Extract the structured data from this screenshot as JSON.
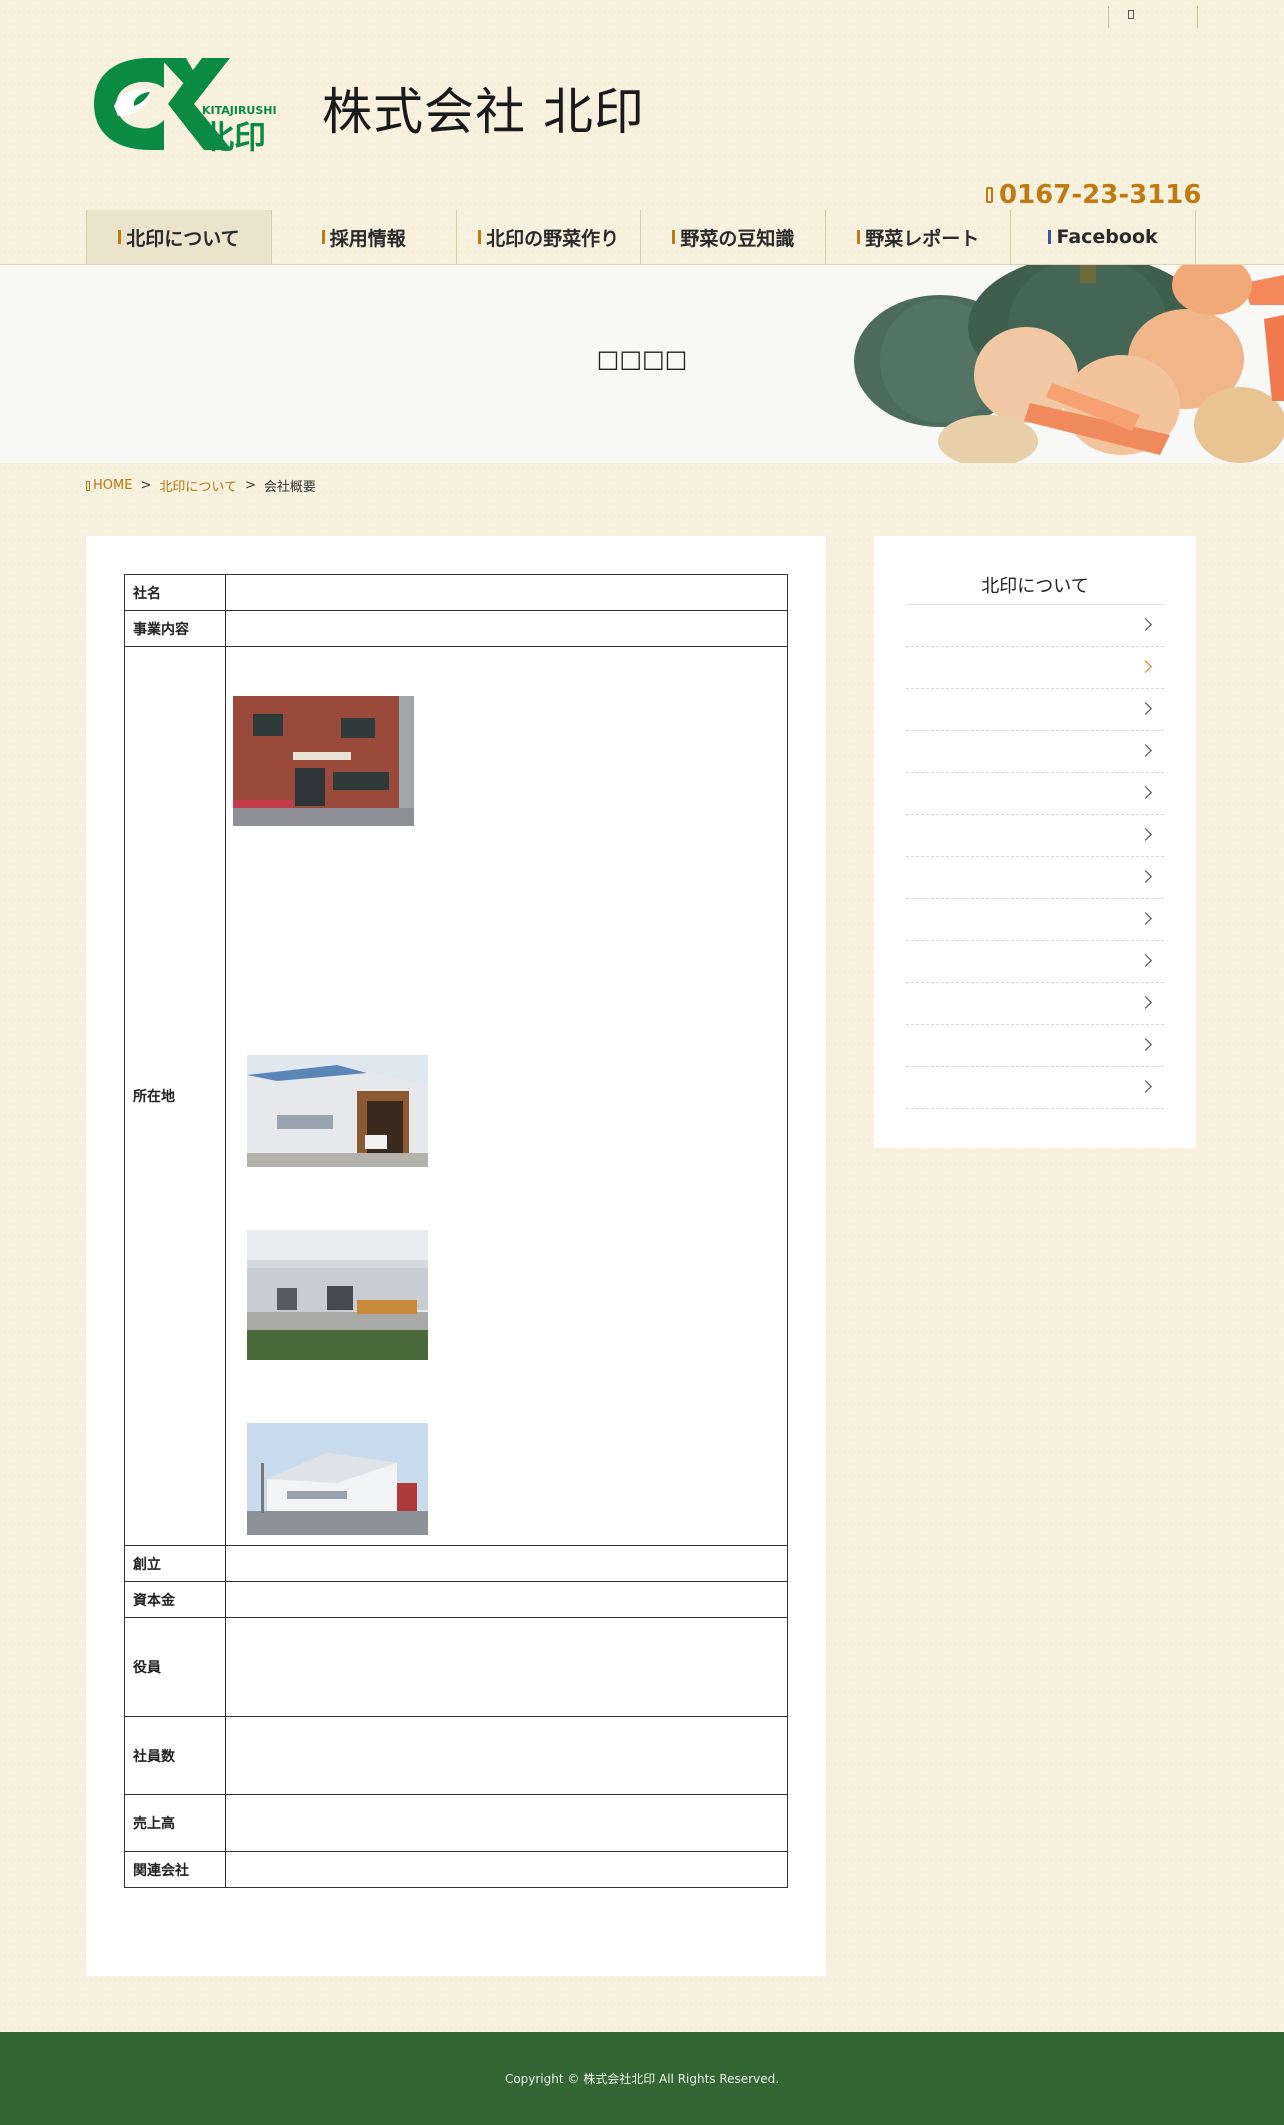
{
  "header": {
    "company_name": "株式会社 北印",
    "logo_text_roman": "KITAJIRUSHI",
    "logo_text_kanji": "北印",
    "phone": "0167-23-3116"
  },
  "nav": {
    "items": [
      {
        "label": "北印について"
      },
      {
        "label": "採用情報"
      },
      {
        "label": "北印の野菜作り"
      },
      {
        "label": "野菜の豆知識"
      },
      {
        "label": "野菜レポート"
      },
      {
        "label": "Facebook"
      }
    ]
  },
  "hero": {
    "title": "□□□□"
  },
  "breadcrumb": {
    "home": "HOME",
    "sep": ">",
    "parent": "北印について",
    "current": "会社概要"
  },
  "profile": {
    "rows": [
      {
        "label": "社名"
      },
      {
        "label": "事業内容"
      },
      {
        "label": "所在地"
      },
      {
        "label": "創立"
      },
      {
        "label": "資本金"
      },
      {
        "label": "役員"
      },
      {
        "label": "社員数"
      },
      {
        "label": "売上高"
      },
      {
        "label": "関連会社"
      }
    ]
  },
  "sidebar": {
    "title": "北印について",
    "item_count": 12,
    "active_index": 1
  },
  "footer": {
    "copyright": "Copyright © 株式会社北印 All Rights Reserved."
  },
  "colors": {
    "accent": "#c07a12",
    "footer": "#336633",
    "logo_green": "#0b8a44",
    "facebook": "#3b5998"
  }
}
